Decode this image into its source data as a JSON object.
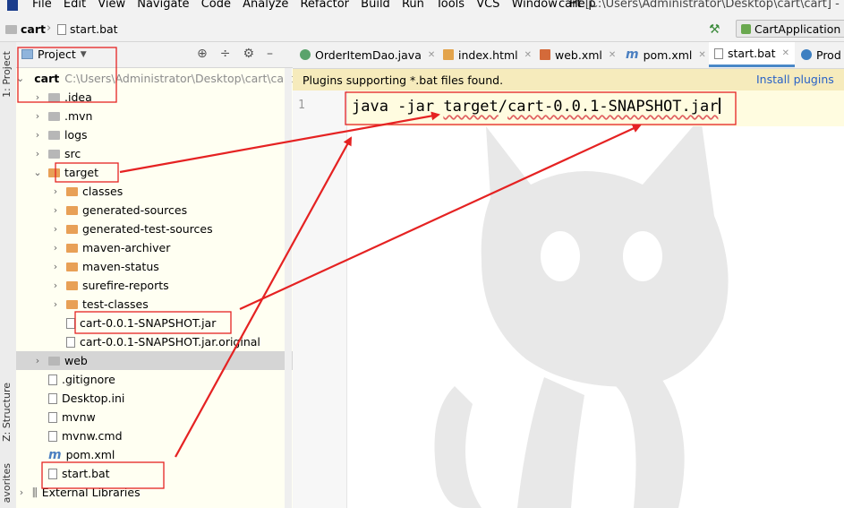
{
  "menubar": {
    "items": [
      "File",
      "Edit",
      "View",
      "Navigate",
      "Code",
      "Analyze",
      "Refactor",
      "Build",
      "Run",
      "Tools",
      "VCS",
      "Window",
      "Help"
    ],
    "title_project": "cart",
    "title_path": "[C:\\Users\\Administrator\\Desktop\\cart\\cart] - ...\\sta"
  },
  "navbar": {
    "crumb_project": "cart",
    "crumb_file": "start.bat",
    "run_config": "CartApplication"
  },
  "toolstrip": {
    "project_tab": "1: Project",
    "structure_tab": "Z: Structure",
    "favorites_tab": "avorites"
  },
  "panel": {
    "view_label": "Project"
  },
  "tree": {
    "root_name": "cart",
    "root_path": "C:\\Users\\Administrator\\Desktop\\cart\\cart",
    "rows": [
      {
        "label": ".idea"
      },
      {
        "label": ".mvn"
      },
      {
        "label": "logs"
      },
      {
        "label": "src"
      },
      {
        "label": "target"
      },
      {
        "label": "classes"
      },
      {
        "label": "generated-sources"
      },
      {
        "label": "generated-test-sources"
      },
      {
        "label": "maven-archiver"
      },
      {
        "label": "maven-status"
      },
      {
        "label": "surefire-reports"
      },
      {
        "label": "test-classes"
      },
      {
        "label": "cart-0.0.1-SNAPSHOT.jar"
      },
      {
        "label": "cart-0.0.1-SNAPSHOT.jar.original"
      },
      {
        "label": "web"
      },
      {
        "label": ".gitignore"
      },
      {
        "label": "Desktop.ini"
      },
      {
        "label": "mvnw"
      },
      {
        "label": "mvnw.cmd"
      },
      {
        "label": "pom.xml"
      },
      {
        "label": "start.bat"
      },
      {
        "label": "External Libraries"
      }
    ]
  },
  "tabs": [
    {
      "label": "OrderItemDao.java"
    },
    {
      "label": "index.html"
    },
    {
      "label": "web.xml"
    },
    {
      "label": "pom.xml"
    },
    {
      "label": "start.bat"
    },
    {
      "label": "Prod"
    }
  ],
  "notice": {
    "message": "Plugins supporting *.bat files found.",
    "action": "Install plugins"
  },
  "editor": {
    "line_number": "1",
    "code_prefix": "java -jar ",
    "code_target": "target",
    "code_slash": "/",
    "code_jar": "cart-0.0.1-SNAPSHOT.jar"
  },
  "colors": {
    "annotation": "#e52222",
    "tree_background": "#fffff2",
    "notice_background": "#f6ebbc",
    "link": "#2861c7"
  }
}
